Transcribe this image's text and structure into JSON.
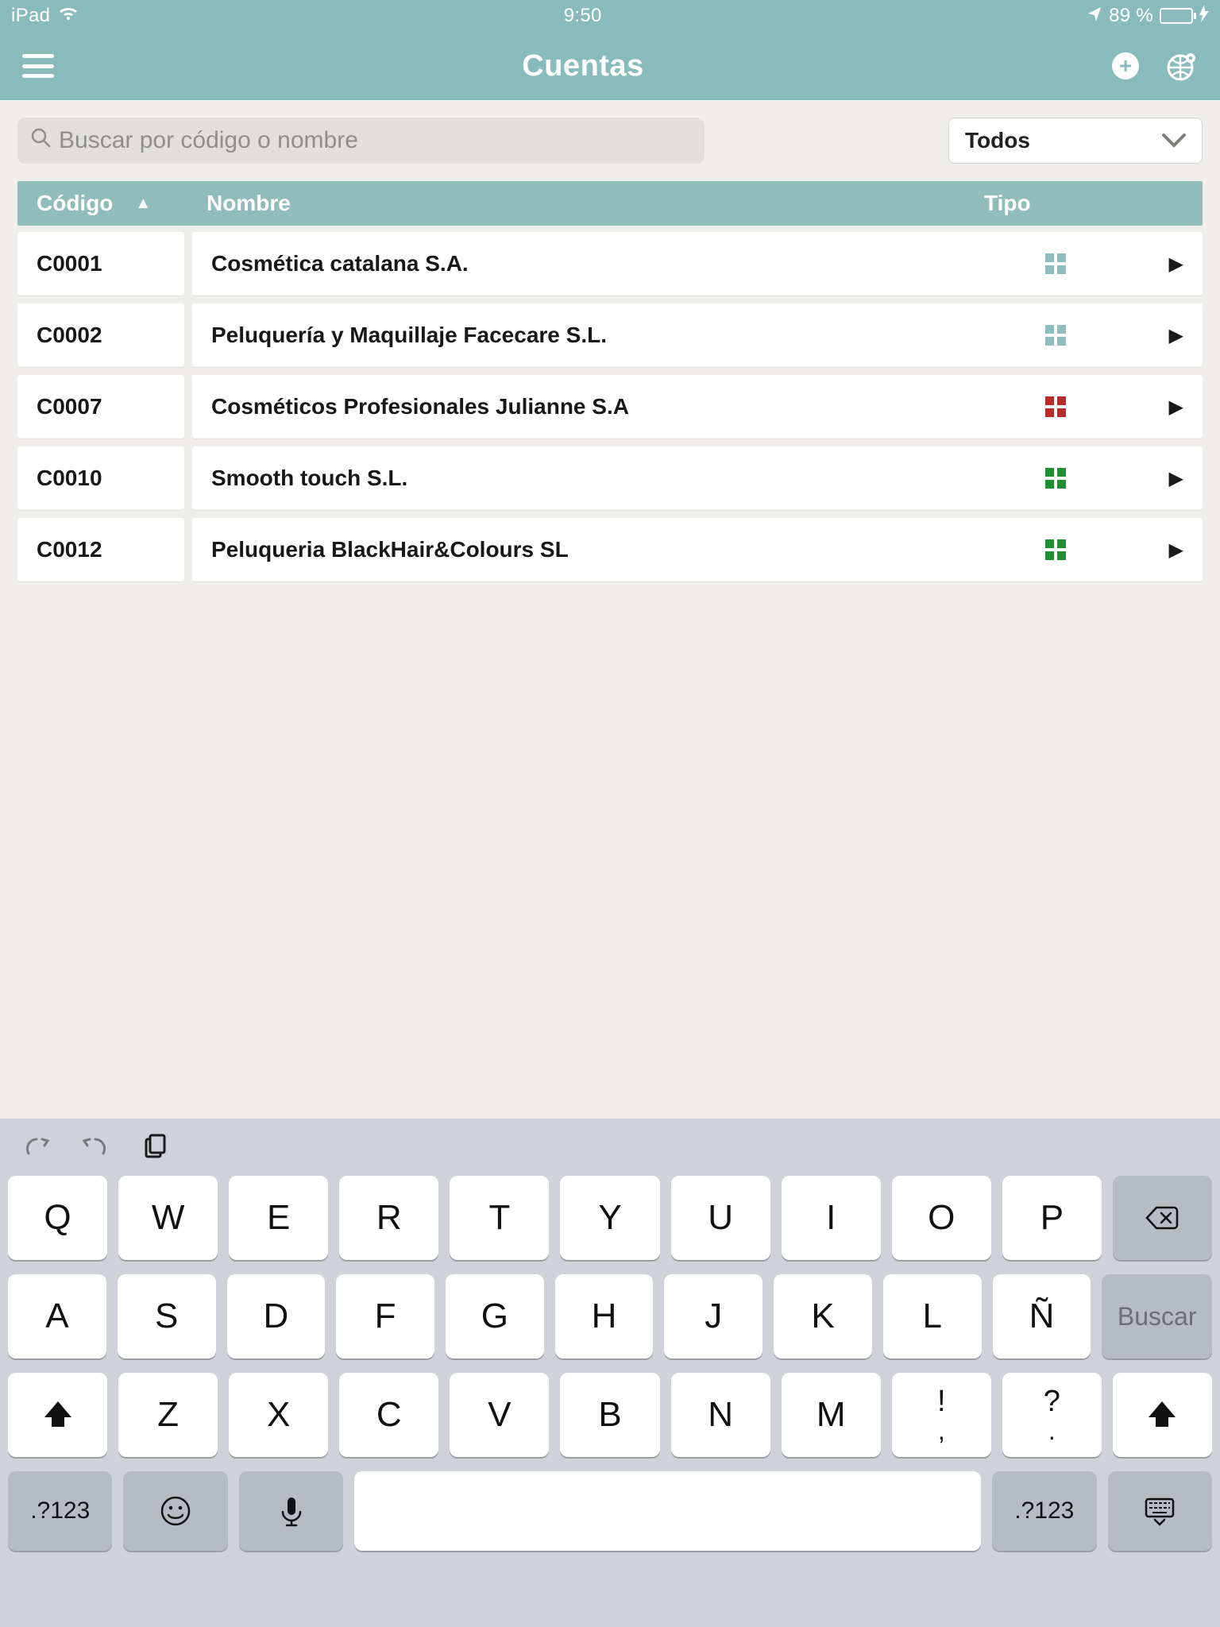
{
  "status": {
    "device": "iPad",
    "time": "9:50",
    "battery_pct": "89 %",
    "battery_fill_pct": 89
  },
  "nav": {
    "title": "Cuentas"
  },
  "search": {
    "placeholder": "Buscar por código o nombre"
  },
  "filter": {
    "selected": "Todos"
  },
  "table": {
    "headers": {
      "code": "Código",
      "name": "Nombre",
      "type": "Tipo"
    },
    "rows": [
      {
        "code": "C0001",
        "name": "Cosmética catalana S.A.",
        "type_color": "#8fbcbd"
      },
      {
        "code": "C0002",
        "name": "Peluquería y Maquillaje Facecare S.L.",
        "type_color": "#8fbcbd"
      },
      {
        "code": "C0007",
        "name": "Cosméticos Profesionales Julianne S.A",
        "type_color": "#b92a2a"
      },
      {
        "code": "C0010",
        "name": "Smooth touch S.L.",
        "type_color": "#1f8f33"
      },
      {
        "code": "C0012",
        "name": "Peluqueria BlackHair&Colours SL",
        "type_color": "#1f8f33"
      }
    ]
  },
  "keyboard": {
    "row1": [
      "Q",
      "W",
      "E",
      "R",
      "T",
      "Y",
      "U",
      "I",
      "O",
      "P"
    ],
    "row2": [
      "A",
      "S",
      "D",
      "F",
      "G",
      "H",
      "J",
      "K",
      "L",
      "Ñ"
    ],
    "row3_letters": [
      "Z",
      "X",
      "C",
      "V",
      "B",
      "N",
      "M"
    ],
    "row3_punct": [
      [
        "!",
        ","
      ],
      [
        "?",
        "."
      ]
    ],
    "row4": {
      "numkey": ".?123"
    },
    "search_label": "Buscar"
  }
}
